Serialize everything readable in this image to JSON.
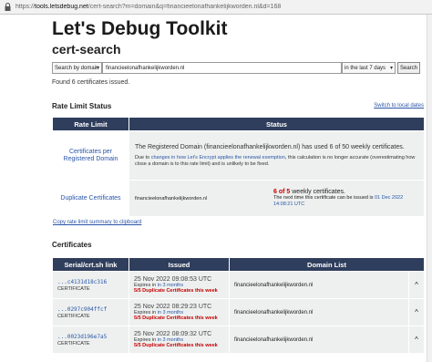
{
  "browser": {
    "url_prefix": "https://",
    "url_host": "tools.letsdebug.net",
    "url_rest": "/cert-search?m=domain&q=financieelonafhankelijkworden.nl&d=168"
  },
  "page": {
    "title": "Let's Debug Toolkit",
    "subtitle": "cert-search"
  },
  "search": {
    "mode": "Search by domain",
    "query": "financieelonafhankelijkworden.nl",
    "period": "in the last 7 days",
    "button": "Search"
  },
  "found_text": "Found 6 certificates issued.",
  "rate_limit": {
    "heading": "Rate Limit Status",
    "switch_link": "Switch to local dates",
    "col_name": "Rate Limit",
    "col_status": "Status",
    "rows": [
      {
        "name": "Certificates per Registered Domain",
        "status_main": "The Registered Domain (financieelonafhankelijkworden.nl) has used 6 of 50 weekly certificates.",
        "note_pre": "Due to ",
        "note_link": "changes in how Let's Encrypt applies the renewal exemption",
        "note_post": ", this calculation is no longer accurate (overestimating how close a domain is to this rate limit) and is unlikely to be fixed."
      },
      {
        "name": "Duplicate Certificates",
        "domain": "financieelonafhankelijkworden.nl",
        "usage_bold": "6 of 5",
        "usage_rest": " weekly certificates.",
        "next_pre": "The next time this certificate can be issued is ",
        "next_date": "01 Dec 2022 14:08:21 UTC"
      }
    ]
  },
  "copy_link": "Copy rate limit summary to clipboard",
  "certificates": {
    "heading": "Certificates",
    "col_link": "Serial/crt.sh link",
    "col_issued": "Issued",
    "col_domains": "Domain List",
    "rows": [
      {
        "serial": "...c4131d18c316",
        "type": "CERTIFICATE",
        "issued": "25 Nov 2022 09:08:53 UTC",
        "expires_pre": "Expires in ",
        "expires_link": "in 3 months",
        "dup": "5/5 Duplicate Certificates this week",
        "domain": "financieelonafhankelijkworden.nl",
        "toggle": "^"
      },
      {
        "serial": "...0297c904ffcf",
        "type": "CERTIFICATE",
        "issued": "25 Nov 2022 08:29:23 UTC",
        "expires_pre": "Expires in ",
        "expires_link": "in 3 months",
        "dup": "5/5 Duplicate Certificates this week",
        "domain": "financieelonafhankelijkworden.nl",
        "toggle": "^"
      },
      {
        "serial": "...0023d196e7a5",
        "type": "CERTIFICATE",
        "issued": "25 Nov 2022 08:09:32 UTC",
        "expires_pre": "Expires in ",
        "expires_link": "in 3 months",
        "dup": "5/5 Duplicate Certificates this week",
        "domain": "financieelonafhankelijkworden.nl",
        "toggle": "^"
      }
    ]
  }
}
